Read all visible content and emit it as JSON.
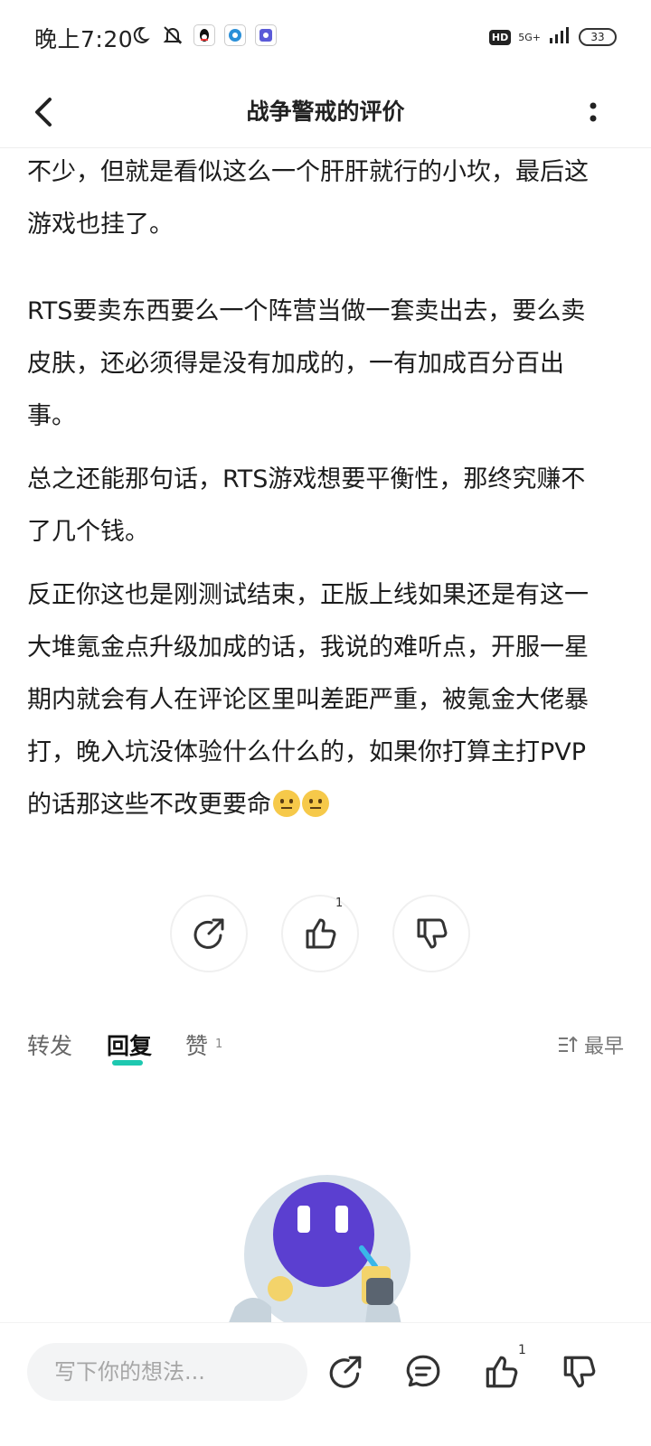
{
  "status_bar": {
    "time": "晚上7:20",
    "network_type": "5G+",
    "hd_label": "HD",
    "battery": "33",
    "notification_icons": [
      "moon-icon",
      "bell-off-icon",
      "qq-icon",
      "browser-icon",
      "app-icon"
    ]
  },
  "header": {
    "title": "战争警戒的评价"
  },
  "content": {
    "paragraphs": [
      "东东风暴入侍需要金币解锁，而且这金币获得途径也不少，但就是看似这么一个肝肝就行的小坎，最后这游戏也挂了。",
      "RTS要卖东西要么一个阵营当做一套卖出去，要么卖皮肤，还必须得是没有加成的，一有加成百分百出事。",
      "总之还能那句话，RTS游戏想要平衡性，那终究赚不了几个钱。",
      "反正你这也是刚测试结束，正版上线如果还是有这一大堆氪金点升级加成的话，我说的难听点，开服一星期内就会有人在评论区里叫差距严重，被氪金大佬暴打，晚入坑没体验什么什么的，如果你打算主打PVP的话那这些不改更要命"
    ],
    "trailing_emojis": [
      "neutral-face-emoji",
      "neutral-face-emoji"
    ]
  },
  "actions": {
    "like_count": "1"
  },
  "tabs": {
    "items": [
      {
        "label": "转发"
      },
      {
        "label": "回复"
      },
      {
        "label": "赞"
      }
    ],
    "like_tab_count": "1",
    "sort_label": "最早"
  },
  "bottom_bar": {
    "input_placeholder": "写下你的想法...",
    "like_count": "1"
  },
  "colors": {
    "accent": "#1ec8b0",
    "text": "#1c1c1c",
    "mascot_head": "#5b3fd0"
  }
}
